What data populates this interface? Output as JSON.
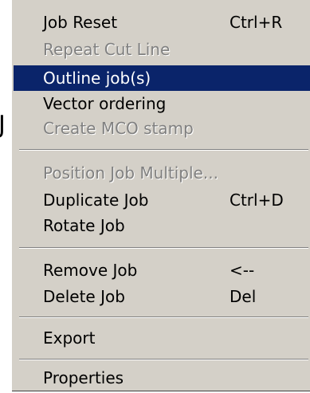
{
  "background": {
    "fragment_text": "J"
  },
  "menu": {
    "colors": {
      "face": "#d4d0c8",
      "highlight": "#0a246a",
      "highlight_text": "#ffffff",
      "disabled_text": "#808080"
    },
    "items": [
      {
        "label": "Job Reset",
        "shortcut": "Ctrl+R",
        "enabled": true,
        "selected": false
      },
      {
        "label": "Repeat Cut Line",
        "shortcut": "",
        "enabled": false,
        "selected": false
      },
      {
        "label": "Outline job(s)",
        "shortcut": "",
        "enabled": true,
        "selected": true
      },
      {
        "label": "Vector ordering",
        "shortcut": "",
        "enabled": true,
        "selected": false
      },
      {
        "label": "Create MCO stamp",
        "shortcut": "",
        "enabled": false,
        "selected": false
      },
      {
        "label": "Position Job Multiple...",
        "shortcut": "",
        "enabled": false,
        "selected": false
      },
      {
        "label": "Duplicate Job",
        "shortcut": "Ctrl+D",
        "enabled": true,
        "selected": false
      },
      {
        "label": "Rotate Job",
        "shortcut": "",
        "enabled": true,
        "selected": false
      },
      {
        "label": "Remove Job",
        "shortcut": "<--",
        "enabled": true,
        "selected": false
      },
      {
        "label": "Delete Job",
        "shortcut": "Del",
        "enabled": true,
        "selected": false
      },
      {
        "label": "Export",
        "shortcut": "",
        "enabled": true,
        "selected": false
      },
      {
        "label": "Properties",
        "shortcut": "",
        "enabled": true,
        "selected": false
      }
    ]
  }
}
